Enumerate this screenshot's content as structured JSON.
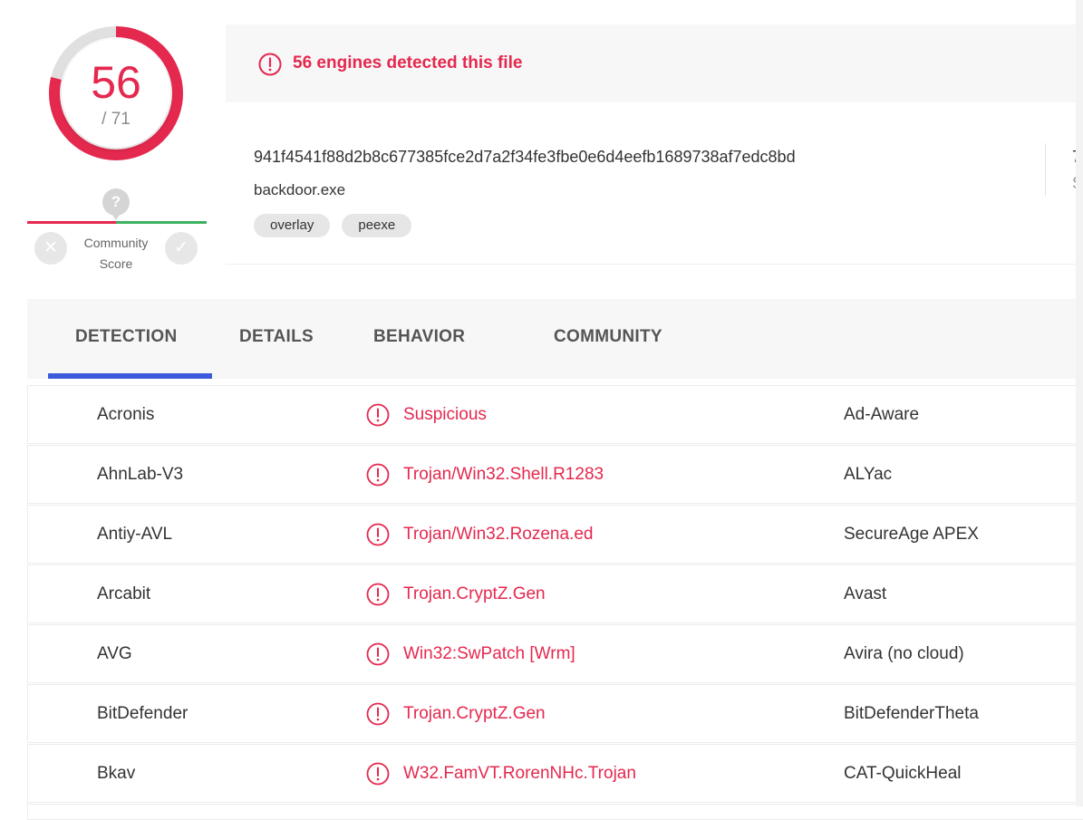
{
  "score": {
    "detected": "56",
    "total": "/ 71",
    "fraction": 0.7887,
    "color": "#e5284e"
  },
  "community": {
    "marker": "?",
    "label_line1": "Community",
    "label_line2": "Score",
    "no_glyph": "✕",
    "yes_glyph": "✓"
  },
  "banner": {
    "text": "56 engines detected this file",
    "icon": "alert-circle-icon"
  },
  "file": {
    "hash": "941f4541f88d2b8c677385fce2d7a2f34fe3fbe0e6d4eefb1689738af7edc8bd",
    "name": "backdoor.exe",
    "tags": [
      "overlay",
      "peexe"
    ],
    "size_value_partial": "7",
    "size_label_partial": "S"
  },
  "tabs": [
    "DETECTION",
    "DETAILS",
    "BEHAVIOR",
    "COMMUNITY"
  ],
  "active_tab": "DETECTION",
  "detections": [
    {
      "engine": "Acronis",
      "result": "Suspicious",
      "engine2": "Ad-Aware"
    },
    {
      "engine": "AhnLab-V3",
      "result": "Trojan/Win32.Shell.R1283",
      "engine2": "ALYac"
    },
    {
      "engine": "Antiy-AVL",
      "result": "Trojan/Win32.Rozena.ed",
      "engine2": "SecureAge APEX"
    },
    {
      "engine": "Arcabit",
      "result": "Trojan.CryptZ.Gen",
      "engine2": "Avast"
    },
    {
      "engine": "AVG",
      "result": "Win32:SwPatch [Wrm]",
      "engine2": "Avira (no cloud)"
    },
    {
      "engine": "BitDefender",
      "result": "Trojan.CryptZ.Gen",
      "engine2": "BitDefenderTheta"
    },
    {
      "engine": "Bkav",
      "result": "W32.FamVT.RorenNHc.Trojan",
      "engine2": "CAT-QuickHeal"
    }
  ]
}
